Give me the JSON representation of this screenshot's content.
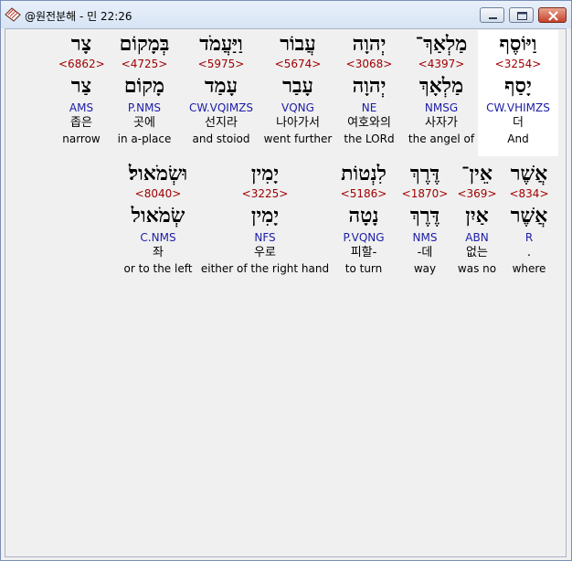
{
  "window": {
    "title": "@원전분해 - 민 22:26",
    "icon": "book-bookmark-icon",
    "buttons": [
      "minimize-icon",
      "maximize-icon",
      "close-icon"
    ]
  },
  "row1": [
    {
      "hebrew": "וַיּוֹסֶף",
      "strong": "<3254>",
      "root": "יָסַף",
      "parse": "CW.VHIMZS",
      "korean": "더",
      "english": "And",
      "selected": true
    },
    {
      "hebrew": "מַלְאַךְ־",
      "strong": "<4397>",
      "root": "מַלְאָךְ",
      "parse": "NMSG",
      "korean": "사자가",
      "english": "the angel of"
    },
    {
      "hebrew": "יְהוָה",
      "strong": "<3068>",
      "root": "יְהוָה",
      "parse": "NE",
      "korean": "여호와의",
      "english": "the LORd"
    },
    {
      "hebrew": "עֲבוֹר",
      "strong": "<5674>",
      "root": "עָבַר",
      "parse": "VQNG",
      "korean": "나아가서",
      "english": "went further"
    },
    {
      "hebrew": "וַיַּעֲמֹד",
      "strong": "<5975>",
      "root": "עָמַד",
      "parse": "CW.VQIMZS",
      "korean": "선지라",
      "english": "and stoiod"
    },
    {
      "hebrew": "בְּמָקוֹם",
      "strong": "<4725>",
      "root": "מָקוֹם",
      "parse": "P.NMS",
      "korean": "곳에",
      "english": "in a-place"
    },
    {
      "hebrew": "צָר",
      "strong": "<6862>",
      "root": "צַר",
      "parse": "AMS",
      "korean": "좁은",
      "english": "narrow"
    }
  ],
  "row2": [
    {
      "hebrew": "אֲשֶׁר",
      "strong": "<834>",
      "root": "אֲשֶׁר",
      "parse": "R",
      "korean": ".",
      "english": "where"
    },
    {
      "hebrew": "אֵין־",
      "strong": "<369>",
      "root": "אַיִן",
      "parse": "ABN",
      "korean": "없는",
      "english": "was no"
    },
    {
      "hebrew": "דֶּרֶךְ",
      "strong": "<1870>",
      "root": "דֶּרֶךְ",
      "parse": "NMS",
      "korean": "-데",
      "english": "way"
    },
    {
      "hebrew": "לִנְטוֹת",
      "strong": "<5186>",
      "root": "נָטָה",
      "parse": "P.VQNG",
      "korean": "피할-",
      "english": "to turn"
    },
    {
      "hebrew": "יָמִין",
      "strong": "<3225>",
      "root": "יָמִין",
      "parse": "NFS",
      "korean": "우로",
      "english": "either of the right hand"
    },
    {
      "hebrew": "וּשְׂמֹאול׃",
      "strong": "<8040>",
      "root": "שְׂמֹאול",
      "parse": "C.NMS",
      "korean": "좌",
      "english": "or to the left"
    }
  ]
}
